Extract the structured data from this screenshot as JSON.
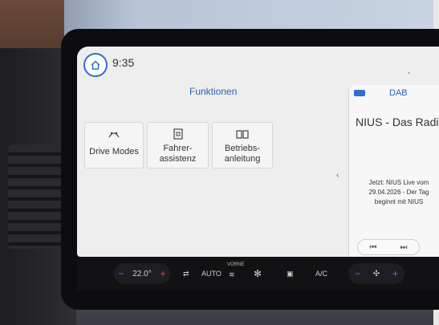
{
  "status_bar": {
    "time": "9:35"
  },
  "main": {
    "title": "Funktionen",
    "tiles": [
      {
        "icon": "drive-modes-icon",
        "label": "Drive Modes"
      },
      {
        "icon": "driver-assist-icon",
        "label": "Fahrer-\nassistenz"
      },
      {
        "icon": "manual-book-icon",
        "label": "Betriebs-\nanleitung"
      }
    ]
  },
  "radio": {
    "source": "DAB",
    "station": "NIUS - Das Radio",
    "radiotext": "Jetzt: NIUS Live vom 29.04.2026 - Der Tag beginnt mit NIUS",
    "prev": "⏮",
    "next": "⏭"
  },
  "climate": {
    "temp_left": "22.0°",
    "auto": "AUTO",
    "vorne": "VORNE",
    "ac": "A/C",
    "minus": "−",
    "plus": "+"
  },
  "colors": {
    "accent": "#2b5fb4",
    "background": "#eeeeee"
  }
}
